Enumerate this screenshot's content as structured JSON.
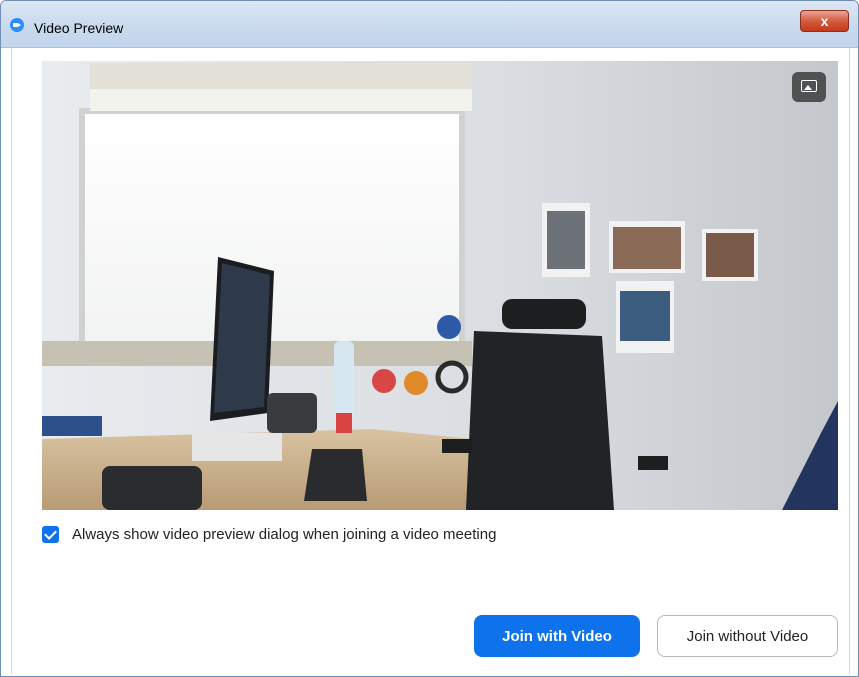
{
  "window": {
    "title": "Video Preview",
    "close_glyph": "x"
  },
  "preview": {
    "change_background_icon": "image-icon"
  },
  "options": {
    "always_show_label": "Always show video preview dialog when joining a video meeting",
    "always_show_checked": true
  },
  "actions": {
    "join_with_video": "Join with Video",
    "join_without_video": "Join without Video"
  },
  "colors": {
    "accent": "#0e72ed",
    "titlebar": "#c9daee",
    "close": "#c7391d"
  }
}
